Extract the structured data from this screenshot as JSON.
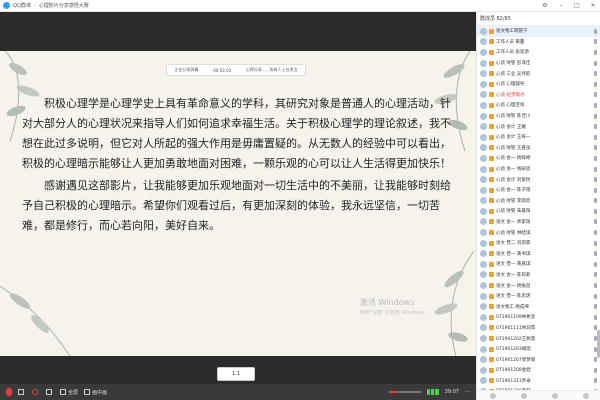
{
  "window": {
    "app_name": "QQ群课",
    "room_title": "心理影片分享感悟大赛",
    "separator": "-"
  },
  "share_bar": {
    "status": "正在分享屏幕",
    "timer": "00:03:03",
    "notice": "心得分享......所有人上台发言"
  },
  "slide": {
    "paragraphs": [
      "积极心理学是心理学史上具有革命意义的学科，其研究对象是普通人的心理活动，针对大部分人的心理状况来指导人们如何追求幸福生活。关于积极心理学的理论叙述，我不想在此过多说明，但它对人所起的强大作用是毋庸置疑的。从无数人的经验中可以看出，积极的心理暗示能够让人更加勇敢地面对困难，一颗乐观的心可以让人生活得更加快乐！",
      "感谢遇见这部影片，让我能够更加乐观地面对一切生活中的不美丽，让我能够时刻给予自己积极的心理暗示。希望你们观看过后，有更加深刻的体验，我永远坚信，一切苦难，都是修行，而心若向阳，美好自来。"
    ],
    "watermark_title": "激活 Windows",
    "watermark_sub": "转到\"设置\"以激活 Windows。"
  },
  "ratio_badge": "1:1",
  "toolbar": {
    "fullscreen": "全屏",
    "picture_in_picture": "画中画",
    "volume_percent": 30,
    "time": "39:07"
  },
  "panel": {
    "header": "群成员 82/85",
    "members": [
      {
        "name": "语文物工网管宁",
        "red": false
      },
      {
        "name": "工作人员 黄蔓",
        "red": false
      },
      {
        "name": "工作人员 张思源",
        "red": false
      },
      {
        "name": "心侦 财管 彭泽佳",
        "red": false
      },
      {
        "name": "心侦 工业 吴伟航",
        "red": false
      },
      {
        "name": "心侦 心理辅导",
        "red": false
      },
      {
        "name": "心侦-赵梦雨丹",
        "red": true
      },
      {
        "name": "心侦 心理咨询",
        "red": false
      },
      {
        "name": "心侦 财管 陈佳川",
        "red": false
      },
      {
        "name": "心侦 会计 王耀",
        "red": false
      },
      {
        "name": "心侦 会计 王梓一",
        "red": false
      },
      {
        "name": "心侦 财管 王嘉汝",
        "red": false
      },
      {
        "name": "心侦 会一 杨辉婷",
        "red": false
      },
      {
        "name": "心侦 会一 钱研思",
        "red": false
      },
      {
        "name": "心侦 会计 刘紫怡",
        "red": false
      },
      {
        "name": "心侦 会一 陈子雨",
        "red": false
      },
      {
        "name": "心侦 财管 李雨欣",
        "red": false
      },
      {
        "name": "心侦 财管 朱嘉阳",
        "red": false
      },
      {
        "name": "语文 会一 师家瑞",
        "red": false
      },
      {
        "name": "心侦 财管 林哈琪",
        "red": false
      },
      {
        "name": "语文 营二 刘雨霏",
        "red": false
      },
      {
        "name": "语文 营一 黄书琪",
        "red": false
      },
      {
        "name": "语文 营一 黄嘉琪",
        "red": false
      },
      {
        "name": "语文 会一 陈莉莉",
        "red": false
      },
      {
        "name": "语文 会一 杨振昌",
        "red": false
      },
      {
        "name": "语文 营一 陈思玥",
        "red": false
      },
      {
        "name": "语文物工 杨成坤",
        "red": false
      },
      {
        "name": "071901109林彬澎",
        "red": false
      },
      {
        "name": "071901111林润萍",
        "red": false
      },
      {
        "name": "071901202王佩蓉",
        "red": false
      },
      {
        "name": "071901203姚雨",
        "red": false
      },
      {
        "name": "071901207郭梦雨",
        "red": false
      },
      {
        "name": "071901208金碧",
        "red": false
      },
      {
        "name": "071901313罗卓",
        "red": false
      },
      {
        "name": "071901318罗莉",
        "red": false
      },
      {
        "name": "071901310郑梓",
        "red": false
      }
    ]
  },
  "colors": {
    "accent_blue": "#2ea1f3",
    "red": "#e03a3a",
    "stage_bg": "#2b2b2b",
    "slide_bg": "#f6f3ec"
  }
}
